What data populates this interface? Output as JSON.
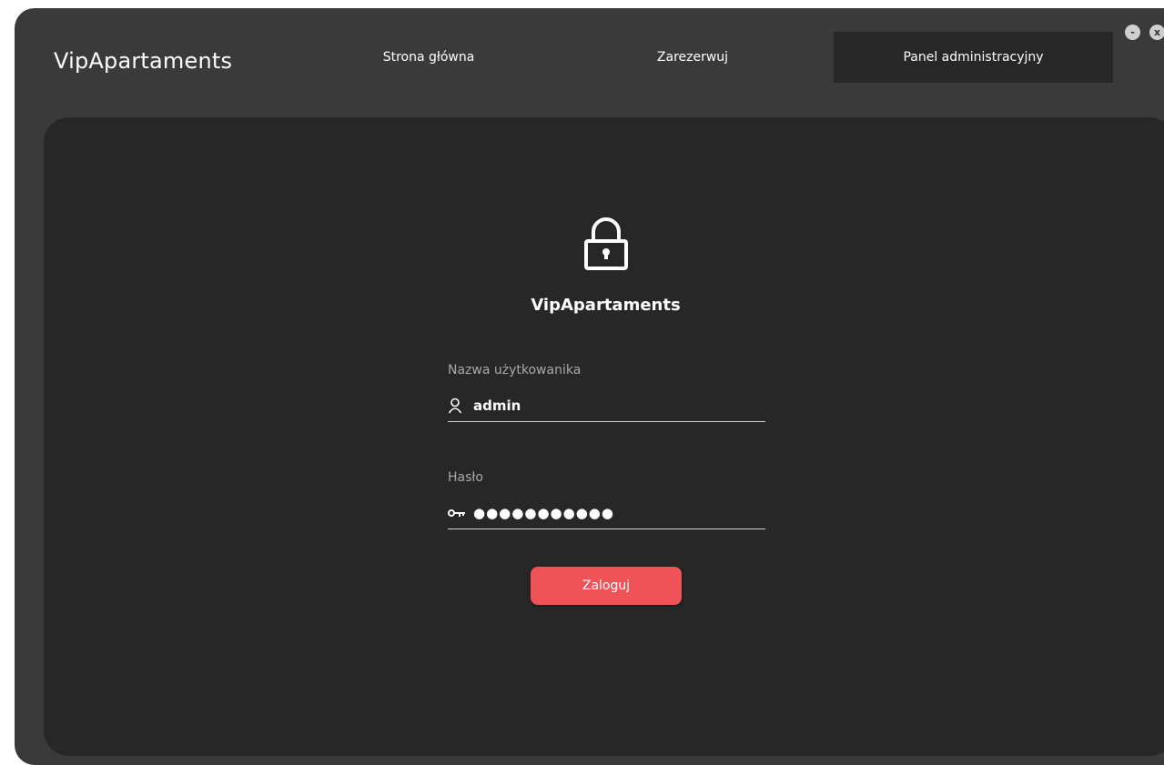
{
  "app": {
    "brand": "VipApartaments"
  },
  "nav": {
    "items": [
      {
        "label": "Strona główna"
      },
      {
        "label": "Zarezerwuj"
      },
      {
        "label": "Panel administracyjny",
        "active": true
      }
    ]
  },
  "window_controls": {
    "minimize_label": "-",
    "close_label": "x"
  },
  "login": {
    "icon": "lock-icon",
    "title": "VipApartaments",
    "username": {
      "label": "Nazwa użytkowanika",
      "icon": "user-icon",
      "value": "admin"
    },
    "password": {
      "label": "Hasło",
      "icon": "key-icon",
      "value": "●●●●●●●●●●●"
    },
    "submit_label": "Zaloguj"
  },
  "colors": {
    "window_bg": "#3a3a3a",
    "panel_bg": "#272727",
    "accent": "#ef5358",
    "text": "#ffffff",
    "label": "#a8a8a8"
  }
}
